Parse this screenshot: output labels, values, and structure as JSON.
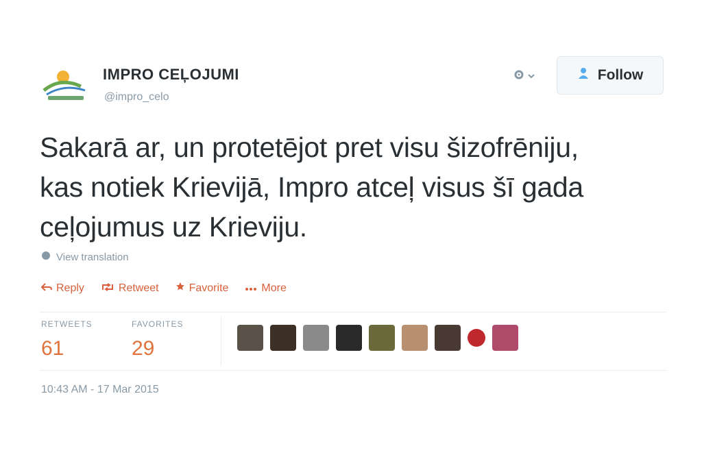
{
  "header": {
    "name": "IMPRO CEĻOJUMI",
    "handle": "@impro_celo",
    "follow_label": "Follow"
  },
  "tweet": {
    "line1": "Sakarā ar, un protetējot pret visu šizofrēniju,",
    "line2": "kas notiek Krievijā, Impro atceļ visus šī gada",
    "line3": "ceļojumus uz Krieviju.",
    "translate_label": "View translation"
  },
  "actions": {
    "reply": "Reply",
    "retweet": "Retweet",
    "favorite": "Favorite",
    "more": "More"
  },
  "stats": {
    "retweets_label": "RETWEETS",
    "retweets_value": "61",
    "favorites_label": "FAVORITES",
    "favorites_value": "29"
  },
  "favoriters": [
    {
      "color": "#5a5248"
    },
    {
      "color": "#3b2f26"
    },
    {
      "color": "#8a8a8a"
    },
    {
      "color": "#2a2a2a"
    },
    {
      "color": "#6b6a3a"
    },
    {
      "color": "#b89070"
    },
    {
      "color": "#4a3a34"
    },
    {
      "color": "#c0282e"
    },
    {
      "color": "#b04a6a"
    }
  ],
  "timestamp": "10:43 AM - 17 Mar 2015",
  "colors": {
    "accent": "#e0733d",
    "muted": "#8899a6",
    "text": "#292f33"
  }
}
